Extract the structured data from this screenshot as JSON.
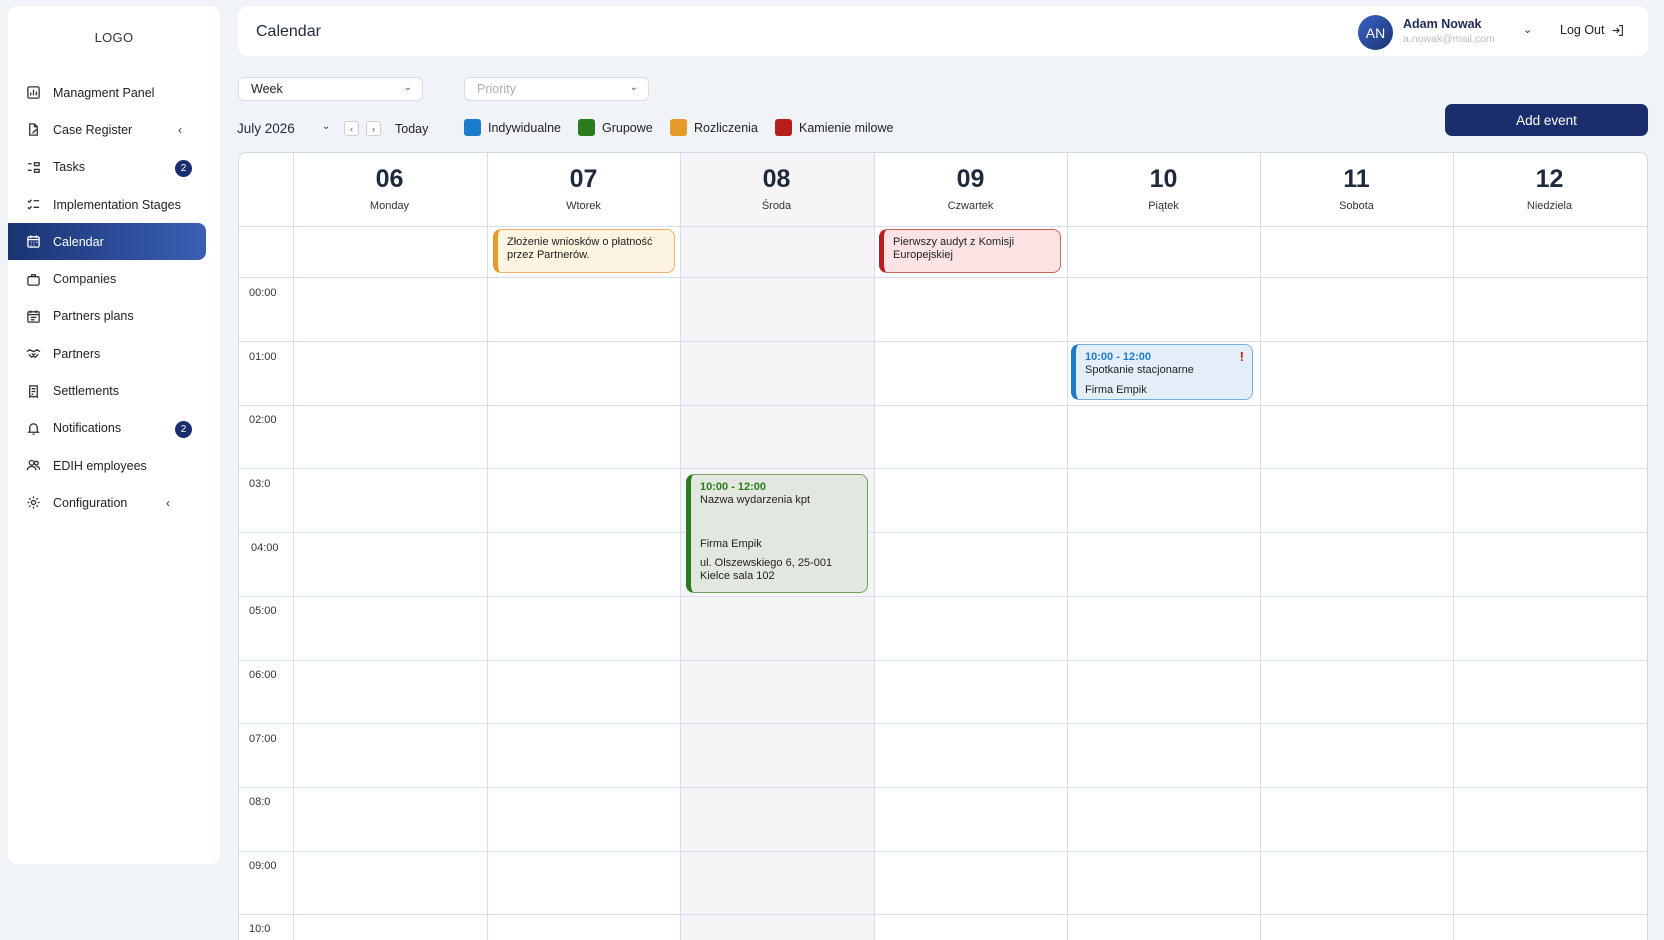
{
  "sidebar": {
    "logo": "LOGO",
    "items": [
      {
        "label": "Managment Panel",
        "icon": "chart-icon"
      },
      {
        "label": "Case Register",
        "icon": "document-icon"
      },
      {
        "label": "Tasks",
        "icon": "tasks-icon",
        "badge": "2"
      },
      {
        "label": "Implementation Stages",
        "icon": "checklist-icon"
      },
      {
        "label": "Calendar",
        "icon": "calendar-icon",
        "active": true
      },
      {
        "label": "Companies",
        "icon": "briefcase-icon"
      },
      {
        "label": "Partners plans",
        "icon": "planner-icon"
      },
      {
        "label": "Partners",
        "icon": "handshake-icon"
      },
      {
        "label": "Settlements",
        "icon": "receipt-icon"
      },
      {
        "label": "Notifications",
        "icon": "bell-icon",
        "badge": "2"
      },
      {
        "label": "EDIH employees",
        "icon": "people-icon"
      },
      {
        "label": "Configuration",
        "icon": "gear-icon"
      }
    ]
  },
  "header": {
    "title": "Calendar",
    "avatar_initials": "AN",
    "user_name": "Adam Nowak",
    "user_email": "a.nowak@mail.com",
    "logout_label": "Log Out"
  },
  "controls": {
    "view_select": "Week",
    "priority_placeholder": "Priority",
    "month": "July 2026",
    "today_label": "Today",
    "add_event_label": "Add event"
  },
  "legend": [
    {
      "label": "Indywidualne",
      "color": "#1a7ccc"
    },
    {
      "label": "Grupowe",
      "color": "#2a7a1e"
    },
    {
      "label": "Rozliczenia",
      "color": "#e69a2a"
    },
    {
      "label": "Kamienie milowe",
      "color": "#b81e1e"
    }
  ],
  "days": [
    {
      "num": "06",
      "name": "Monday"
    },
    {
      "num": "07",
      "name": "Wtorek"
    },
    {
      "num": "08",
      "name": "Środa"
    },
    {
      "num": "09",
      "name": "Czwartek"
    },
    {
      "num": "10",
      "name": "Piątek"
    },
    {
      "num": "11",
      "name": "Sobota"
    },
    {
      "num": "12",
      "name": "Niedziela"
    }
  ],
  "times": [
    "00:00",
    "01:00",
    "02:00",
    "03:0",
    "04:00",
    "05:00",
    "06:00",
    "07:00",
    "08:0",
    "09:00",
    "10:0"
  ],
  "events": {
    "orange": {
      "text": "Złożenie wniosków o płatność przez Partnerów."
    },
    "red": {
      "text": "Pierwszy audyt z Komisji Europejskiej"
    },
    "blue": {
      "time": "10:00 - 12:00",
      "title": "Spotkanie stacjonarne",
      "company": "Firma Empik",
      "priority_mark": "!"
    },
    "green": {
      "time": "10:00 - 12:00",
      "title": "Nazwa wydarzenia kpt",
      "company": "Firma Empik",
      "address": "ul. Olszewskiego 6, 25-001 Kielce sala 102"
    }
  }
}
